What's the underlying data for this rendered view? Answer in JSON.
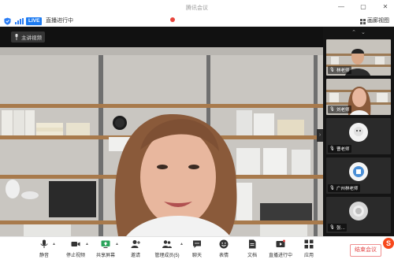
{
  "window": {
    "title": "腾讯会议",
    "controls": [
      "—",
      "▢",
      "✕"
    ]
  },
  "status_bar": {
    "live_badge": "LIVE",
    "live_status": "直播进行中",
    "view_label": "画廊视图"
  },
  "stage": {
    "speaker_chip": "主讲视频"
  },
  "side_panel": {
    "top_controls": [
      "⌃",
      "⌄"
    ],
    "tiles": [
      {
        "name": "林老师"
      },
      {
        "name": "刘老师"
      },
      {
        "name": "曹老师"
      },
      {
        "name": "广州林老师"
      },
      {
        "name": "张…"
      }
    ],
    "side_label": "主讲"
  },
  "toolbar": {
    "items": [
      {
        "label": "静音",
        "icon": "microphone-icon"
      },
      {
        "label": "停止视频",
        "icon": "video-camera-icon"
      },
      {
        "label": "共享屏幕",
        "icon": "share-screen-icon"
      },
      {
        "label": "邀请",
        "icon": "invite-user-icon"
      },
      {
        "label": "管理成员(5)",
        "icon": "members-icon"
      },
      {
        "label": "聊天",
        "icon": "chat-icon"
      },
      {
        "label": "表情",
        "icon": "emoji-icon"
      },
      {
        "label": "文档",
        "icon": "document-icon"
      },
      {
        "label": "直播进行中",
        "icon": "live-broadcast-icon"
      },
      {
        "label": "应用",
        "icon": "apps-icon"
      }
    ],
    "end_button": "结束会议",
    "brand": "S"
  },
  "colors": {
    "accent": "#1e7cf2",
    "danger": "#e24848",
    "toolbar_bg": "#ffffff",
    "stage_bg": "#0e0e0e"
  }
}
